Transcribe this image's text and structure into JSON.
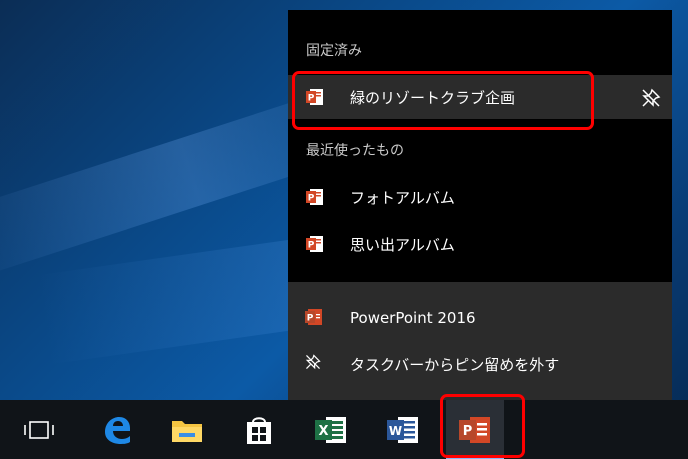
{
  "jumplist": {
    "pinned_header": "固定済み",
    "pinned_items": [
      {
        "label": "緑のリゾートクラブ企画",
        "icon": "powerpoint-file-icon",
        "pin_icon": "unpin-icon"
      }
    ],
    "recent_header": "最近使ったもの",
    "recent_items": [
      {
        "label": "フォトアルバム",
        "icon": "powerpoint-file-icon"
      },
      {
        "label": "思い出アルバム",
        "icon": "powerpoint-file-icon"
      }
    ],
    "tasks": [
      {
        "label": "PowerPoint 2016",
        "icon": "powerpoint-app-icon"
      },
      {
        "label": "タスクバーからピン留めを外す",
        "icon": "unpin-icon"
      }
    ]
  },
  "taskbar": {
    "items": [
      {
        "name": "task-view",
        "icon": "task-view-icon"
      },
      {
        "name": "edge",
        "icon": "edge-icon"
      },
      {
        "name": "file-explorer",
        "icon": "folder-icon"
      },
      {
        "name": "store",
        "icon": "store-icon"
      },
      {
        "name": "excel",
        "icon": "excel-icon"
      },
      {
        "name": "word",
        "icon": "word-icon"
      },
      {
        "name": "powerpoint",
        "icon": "powerpoint-icon"
      }
    ]
  },
  "colors": {
    "accent_red": "#ff0000",
    "powerpoint": "#d24726",
    "excel": "#1e7145",
    "word": "#2b579a",
    "edge": "#1e88e5"
  }
}
